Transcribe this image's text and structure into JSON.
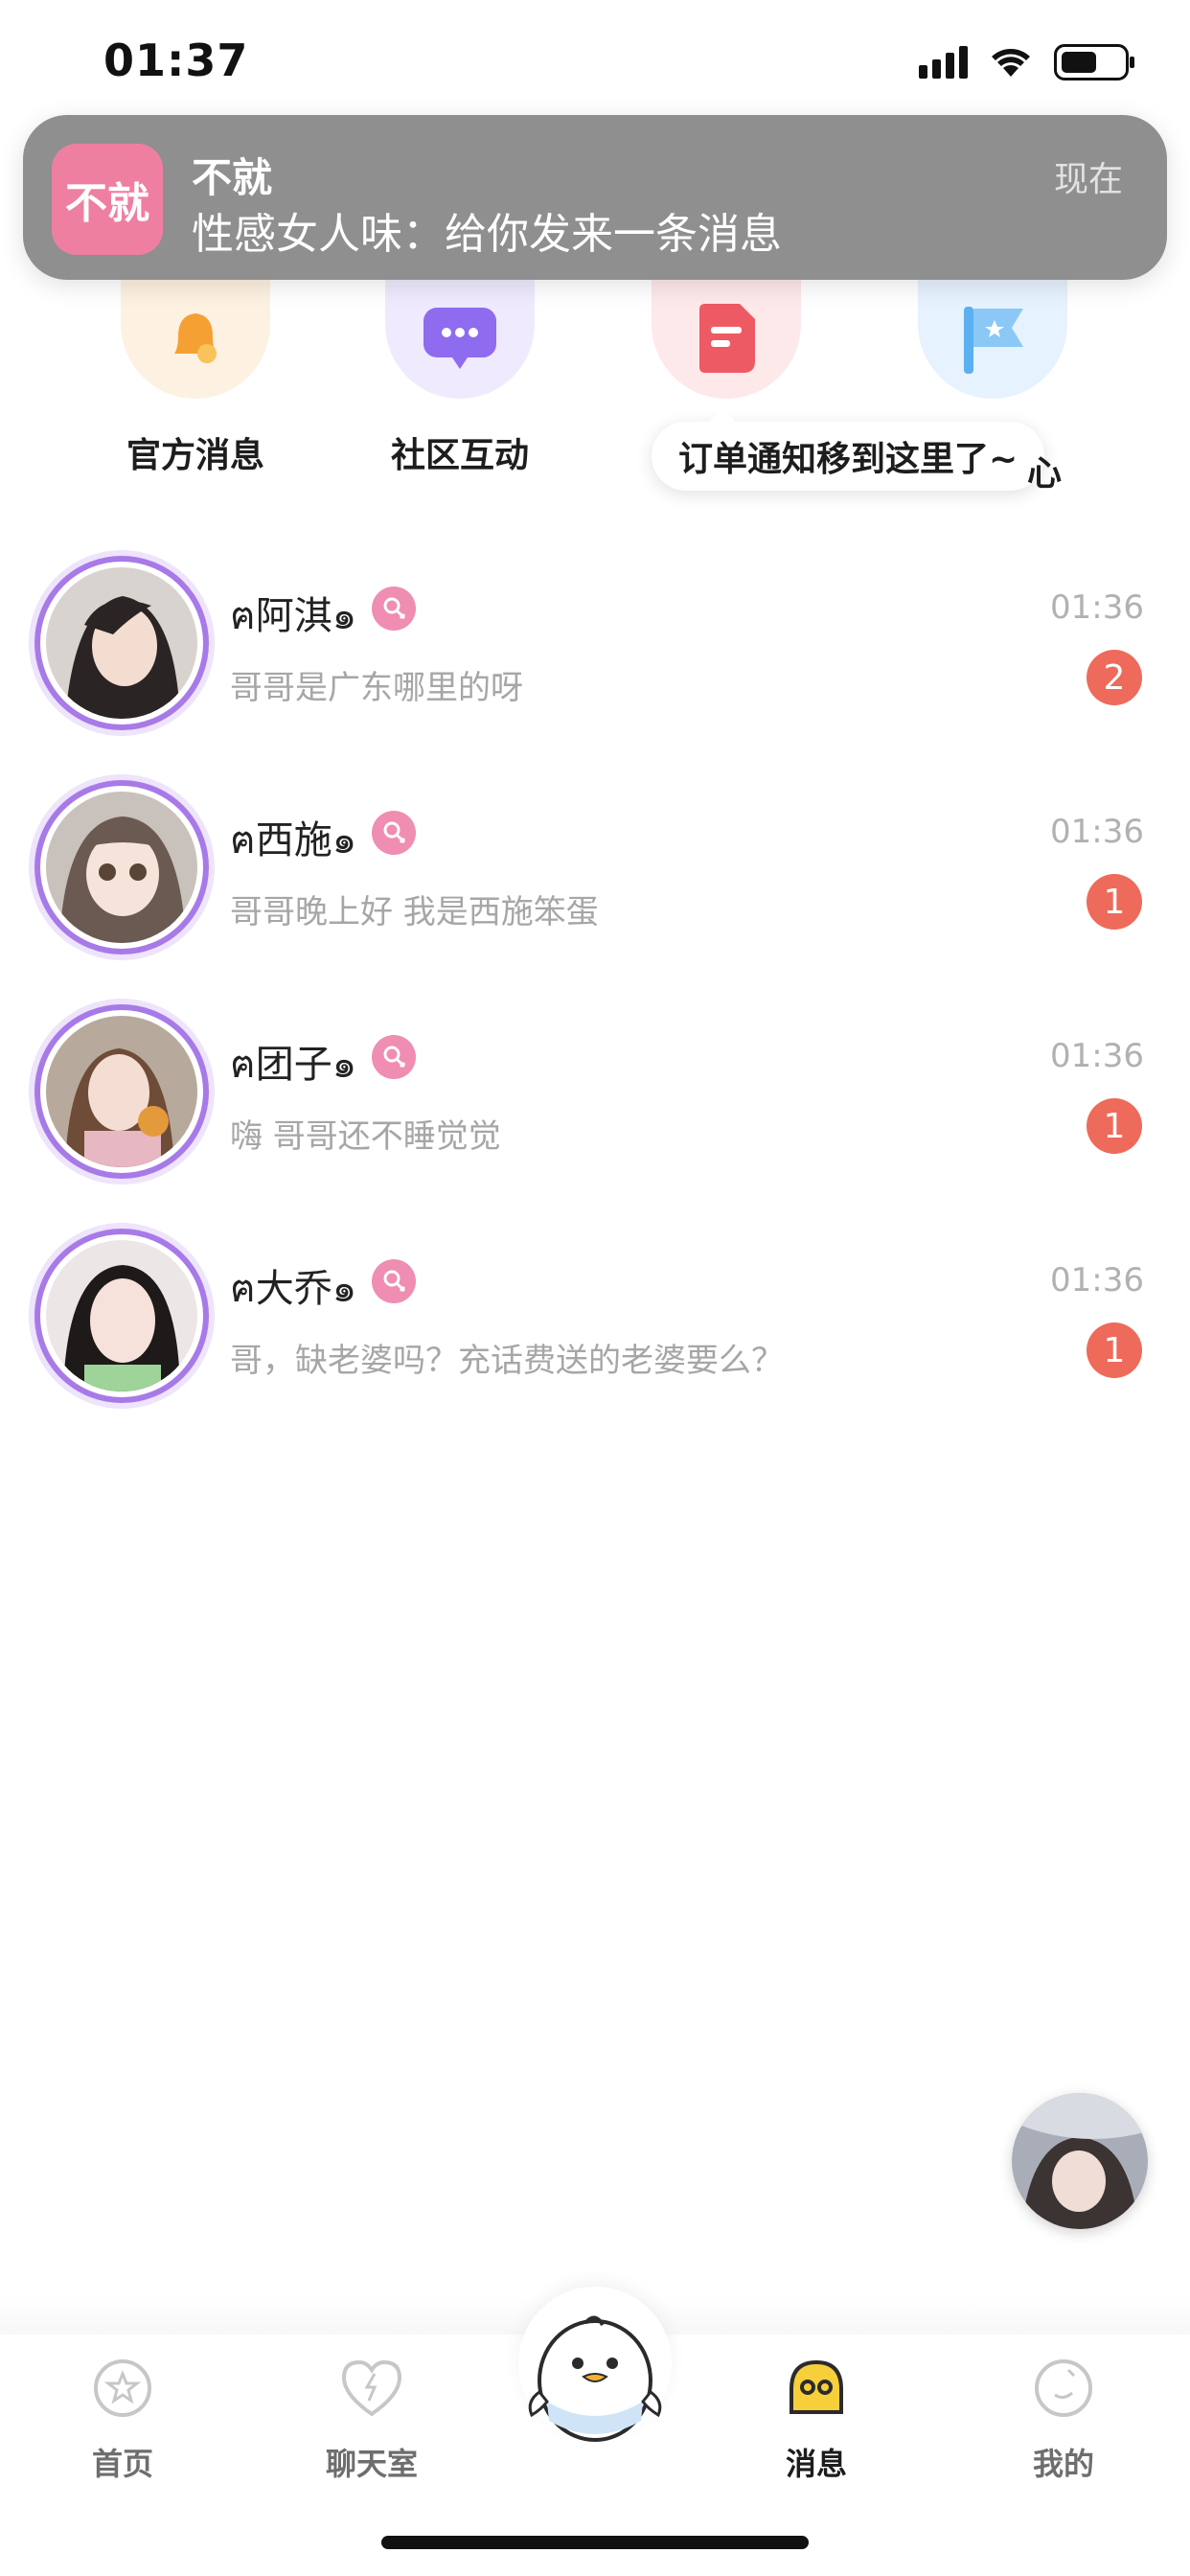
{
  "status_bar": {
    "time": "01:37"
  },
  "notification": {
    "app_icon_text": "不就",
    "title": "不就",
    "message": "性感女人味：给你发来一条消息",
    "time": "现在"
  },
  "quick_entries": [
    {
      "label": "官方消息",
      "icon": "bell-icon",
      "bg": "#fdf1e1",
      "color": "#f5a033"
    },
    {
      "label": "社区互动",
      "icon": "chat-bubble-icon",
      "bg": "#efeafd",
      "color": "#8f6bf0"
    },
    {
      "label": "",
      "icon": "order-doc-icon",
      "bg": "#fde8ea",
      "color": "#ee5a63"
    },
    {
      "label": "",
      "icon": "flag-icon",
      "bg": "#e6f2fd",
      "color": "#5ab0f0"
    }
  ],
  "tooltip": {
    "text": "订单通知移到这里了~",
    "tail": "心"
  },
  "chats": [
    {
      "name": "ฅ阿淇๑",
      "time": "01:36",
      "message": "哥哥是广东哪里的呀",
      "unread": "2"
    },
    {
      "name": "ฅ西施๑",
      "time": "01:36",
      "message": "哥哥晚上好 我是西施笨蛋",
      "unread": "1"
    },
    {
      "name": "ฅ团子๑",
      "time": "01:36",
      "message": "嗨 哥哥还不睡觉觉",
      "unread": "1"
    },
    {
      "name": "ฅ大乔๑",
      "time": "01:36",
      "message": "哥，缺老婆吗？充话费送的老婆要么？",
      "unread": "1"
    }
  ],
  "tabbar": {
    "tabs": [
      {
        "label": "首页",
        "icon": "home-star-icon"
      },
      {
        "label": "聊天室",
        "icon": "heart-lightning-icon"
      },
      {
        "label": "",
        "icon": "mascot-bird-icon"
      },
      {
        "label": "消息",
        "icon": "message-face-icon",
        "active": true
      },
      {
        "label": "我的",
        "icon": "profile-icon"
      }
    ]
  },
  "colors": {
    "accent_purple": "#a77ae8",
    "badge_red": "#ee6a5a",
    "gender_pink": "#f08db2",
    "banner_gray": "#8f8f8f"
  }
}
